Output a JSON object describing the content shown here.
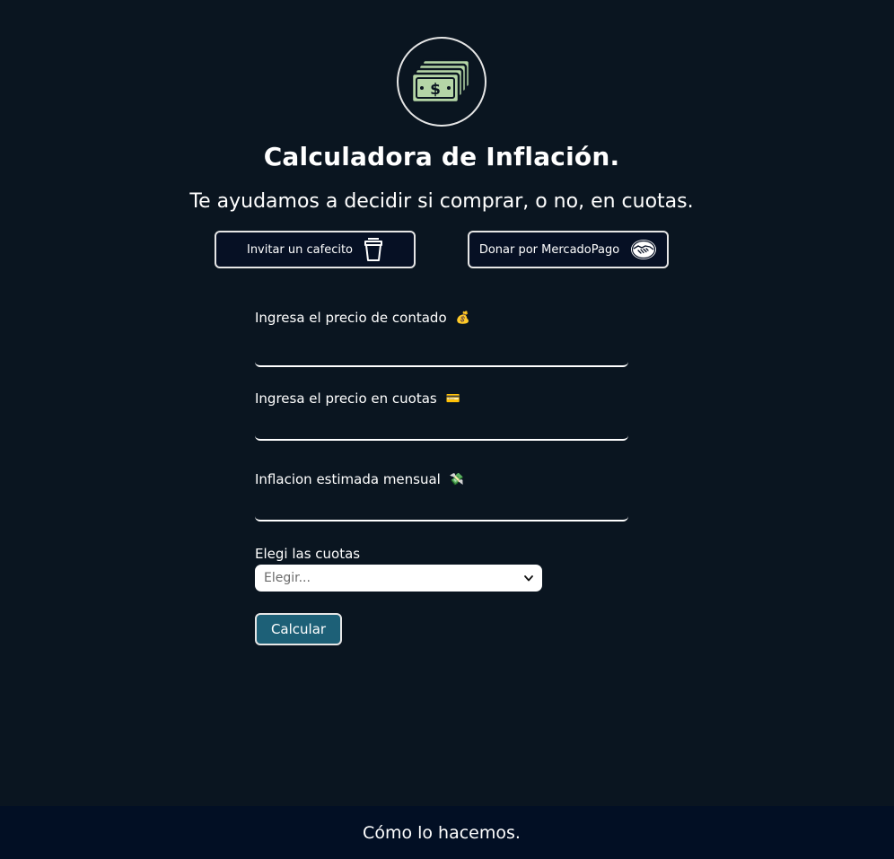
{
  "header": {
    "logo_icon": "money-bills-icon",
    "title": "Calculadora de Inflación.",
    "subtitle": "Te ayudamos a decidir si comprar, o no, en cuotas."
  },
  "support": {
    "coffee_label": "Invitar un cafecito",
    "coffee_icon": "coffee-cup-icon",
    "mercadopago_label": "Donar por MercadoPago",
    "mercadopago_icon": "handshake-icon"
  },
  "form": {
    "contado": {
      "label": "Ingresa el precio de contado",
      "emoji": "💰",
      "value": ""
    },
    "cuotas": {
      "label": "Ingresa el precio en cuotas",
      "emoji": "💳",
      "value": ""
    },
    "inflacion": {
      "label": "Inflacion estimada mensual",
      "emoji": "💸",
      "value": ""
    },
    "select_label": "Elegi las cuotas",
    "select_value": "Elegir...",
    "submit_label": "Calcular"
  },
  "footer": {
    "text": "Cómo lo hacemos."
  },
  "colors": {
    "background": "#0a1520",
    "footer_bg": "#020f24",
    "button_bg": "#061024",
    "accent": "#1d6077",
    "bill_green": "#b5d6a7"
  }
}
